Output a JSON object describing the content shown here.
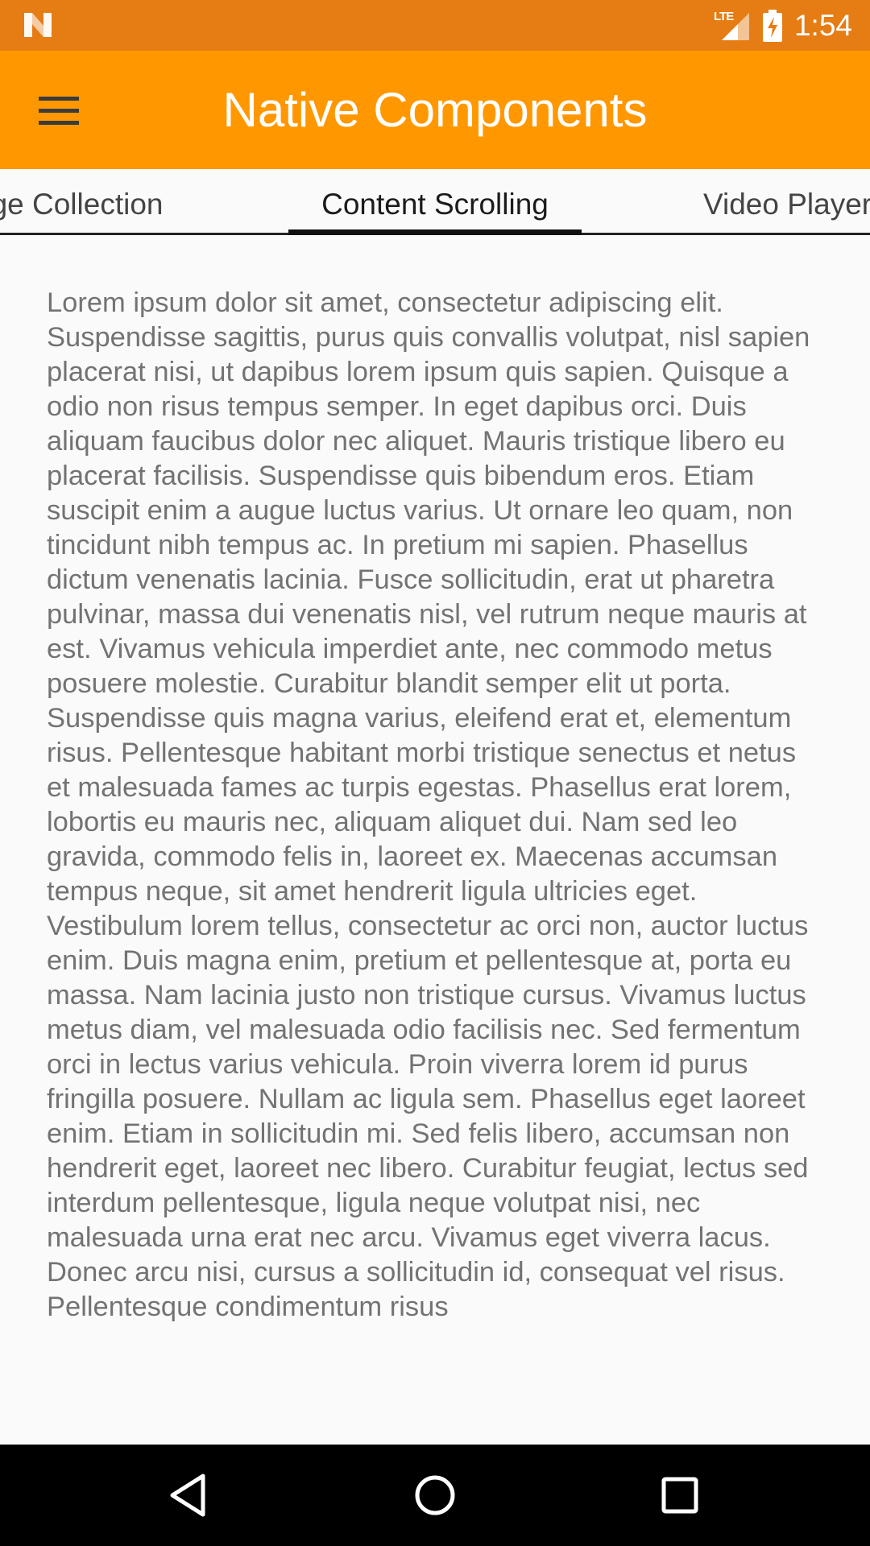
{
  "status_bar": {
    "network_label": "LTE",
    "time": "1:54",
    "background_color": "#E57C14",
    "icons": [
      "notification-n-icon",
      "lte-signal-icon",
      "battery-charging-icon"
    ]
  },
  "app_bar": {
    "title": "Native Components",
    "background_color": "#FF9800",
    "menu_icon": "hamburger-menu-icon"
  },
  "tabs": [
    {
      "label": "age Collection",
      "selected": false
    },
    {
      "label": "Content Scrolling",
      "selected": true
    },
    {
      "label": "Video Player",
      "selected": false
    }
  ],
  "content": {
    "text": "Lorem ipsum dolor sit amet, consectetur adipiscing elit. Suspendisse sagittis, purus quis convallis volutpat, nisl sapien placerat nisi, ut dapibus lorem ipsum quis sapien. Quisque a odio non risus tempus semper. In eget dapibus orci. Duis aliquam faucibus dolor nec aliquet. Mauris tristique libero eu placerat facilisis. Suspendisse quis bibendum eros. Etiam suscipit enim a augue luctus varius. Ut ornare leo quam, non tincidunt nibh tempus ac. In pretium mi sapien. Phasellus dictum venenatis lacinia. Fusce sollicitudin, erat ut pharetra pulvinar, massa dui venenatis nisl, vel rutrum neque mauris at est. Vivamus vehicula imperdiet ante, nec commodo metus posuere molestie. Curabitur blandit semper elit ut porta. Suspendisse quis magna varius, eleifend erat et, elementum risus. Pellentesque habitant morbi tristique senectus et netus et malesuada fames ac turpis egestas. Phasellus erat lorem, lobortis eu mauris nec, aliquam aliquet dui. Nam sed leo gravida, commodo felis in, laoreet ex. Maecenas accumsan tempus neque, sit amet hendrerit ligula ultricies eget. Vestibulum lorem tellus, consectetur ac orci non, auctor luctus enim. Duis magna enim, pretium et pellentesque at, porta eu massa. Nam lacinia justo non tristique cursus. Vivamus luctus metus diam, vel malesuada odio facilisis nec. Sed fermentum orci in lectus varius vehicula. Proin viverra lorem id purus fringilla posuere. Nullam ac ligula sem. Phasellus eget laoreet enim. Etiam in sollicitudin mi. Sed felis libero, accumsan non hendrerit eget, laoreet nec libero. Curabitur feugiat, lectus sed interdum pellentesque, ligula neque volutpat nisi, nec malesuada urna erat nec arcu. Vivamus eget viverra lacus. Donec arcu nisi, cursus a sollicitudin id, consequat vel risus. Pellentesque condimentum risus"
  },
  "nav_bar": {
    "buttons": [
      "back-icon",
      "home-icon",
      "recent-apps-icon"
    ]
  }
}
